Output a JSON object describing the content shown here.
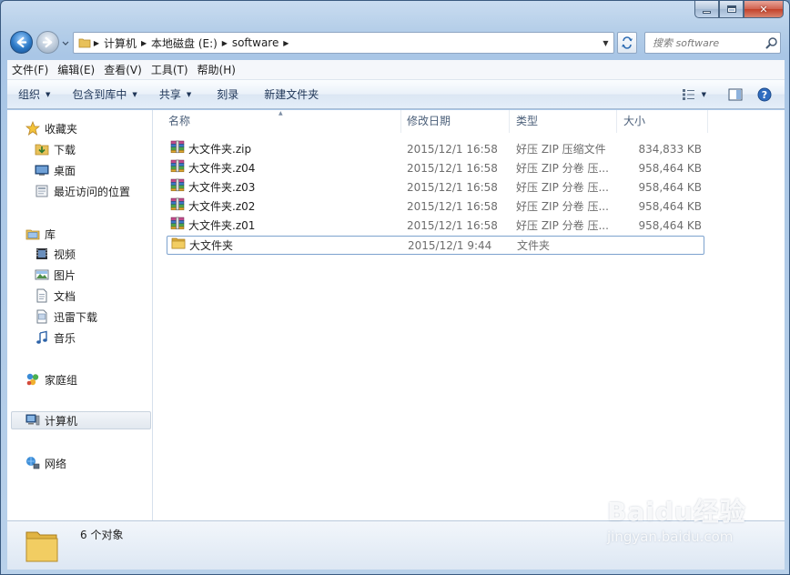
{
  "window": {
    "caption": {
      "minimize": "",
      "maximize": "",
      "close": "✕"
    }
  },
  "address": {
    "crumbs": [
      "计算机",
      "本地磁盘 (E:)",
      "software"
    ]
  },
  "search": {
    "placeholder": "搜索 software"
  },
  "menu": [
    "文件(F)",
    "编辑(E)",
    "查看(V)",
    "工具(T)",
    "帮助(H)"
  ],
  "toolbar": {
    "organize": "组织",
    "include_in_library": "包含到库中",
    "share": "共享",
    "burn": "刻录",
    "new_folder": "新建文件夹"
  },
  "nav": {
    "favorites": {
      "label": "收藏夹",
      "items": [
        "下载",
        "桌面",
        "最近访问的位置"
      ]
    },
    "libraries": {
      "label": "库",
      "items": [
        "视频",
        "图片",
        "文档",
        "迅雷下载",
        "音乐"
      ]
    },
    "homegroup": "家庭组",
    "computer": "计算机",
    "network": "网络"
  },
  "columns": {
    "name": "名称",
    "date": "修改日期",
    "type": "类型",
    "size": "大小"
  },
  "files": [
    {
      "name": "大文件夹.zip",
      "date": "2015/12/1 16:58",
      "type": "好压 ZIP 压缩文件",
      "size": "834,833 KB",
      "icon": "archive-icon"
    },
    {
      "name": "大文件夹.z04",
      "date": "2015/12/1 16:58",
      "type": "好压 ZIP 分卷 压...",
      "size": "958,464 KB",
      "icon": "archive-icon"
    },
    {
      "name": "大文件夹.z03",
      "date": "2015/12/1 16:58",
      "type": "好压 ZIP 分卷 压...",
      "size": "958,464 KB",
      "icon": "archive-icon"
    },
    {
      "name": "大文件夹.z02",
      "date": "2015/12/1 16:58",
      "type": "好压 ZIP 分卷 压...",
      "size": "958,464 KB",
      "icon": "archive-icon"
    },
    {
      "name": "大文件夹.z01",
      "date": "2015/12/1 16:58",
      "type": "好压 ZIP 分卷 压...",
      "size": "958,464 KB",
      "icon": "archive-icon"
    },
    {
      "name": "大文件夹",
      "date": "2015/12/1 9:44",
      "type": "文件夹",
      "size": "",
      "icon": "folder-icon"
    }
  ],
  "status": {
    "count": "6 个对象"
  },
  "watermark": {
    "brand": "Baidu经验",
    "url": "jingyan.baidu.com"
  },
  "colors": {
    "selection_border": "#7da2ce",
    "link_text": "#1e3557",
    "secondary_text": "#6d6d6d"
  }
}
